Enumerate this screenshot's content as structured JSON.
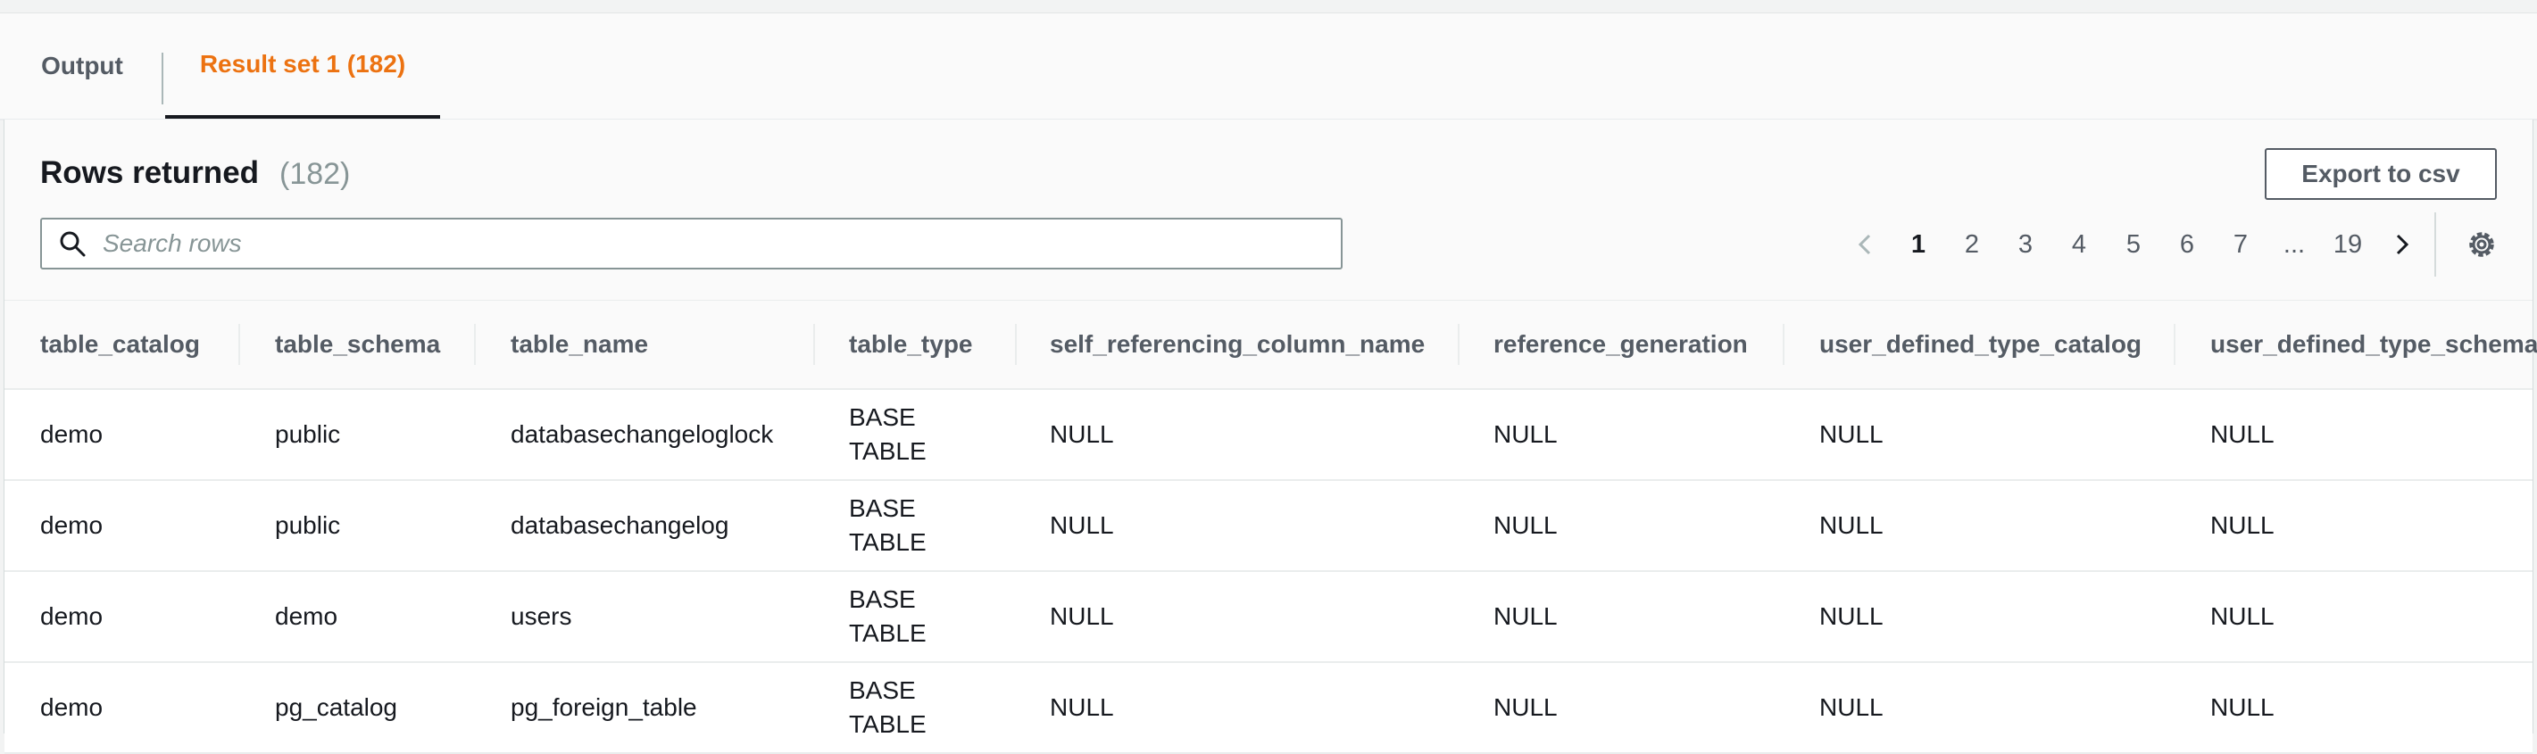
{
  "tabs": [
    {
      "label": "Output"
    },
    {
      "label": "Result set 1 (182)"
    }
  ],
  "header": {
    "title": "Rows returned",
    "count": "(182)",
    "export_label": "Export to csv"
  },
  "search": {
    "placeholder": "Search rows",
    "value": ""
  },
  "pagination": {
    "current": "1",
    "pages": [
      "1",
      "2",
      "3",
      "4",
      "5",
      "6",
      "7",
      "...",
      "19"
    ],
    "prev_icon": "chevron-left-icon",
    "next_icon": "chevron-right-icon"
  },
  "table": {
    "columns": [
      "table_catalog",
      "table_schema",
      "table_name",
      "table_type",
      "self_referencing_column_name",
      "reference_generation",
      "user_defined_type_catalog",
      "user_defined_type_schema"
    ],
    "rows": [
      [
        "demo",
        "public",
        "databasechangeloglock",
        "BASE TABLE",
        "NULL",
        "NULL",
        "NULL",
        "NULL"
      ],
      [
        "demo",
        "public",
        "databasechangelog",
        "BASE TABLE",
        "NULL",
        "NULL",
        "NULL",
        "NULL"
      ],
      [
        "demo",
        "demo",
        "users",
        "BASE TABLE",
        "NULL",
        "NULL",
        "NULL",
        "NULL"
      ],
      [
        "demo",
        "pg_catalog",
        "pg_foreign_table",
        "BASE TABLE",
        "NULL",
        "NULL",
        "NULL",
        "NULL"
      ]
    ]
  },
  "colors": {
    "accent": "#ec7211",
    "text": "#16191f",
    "muted": "#545b64"
  }
}
